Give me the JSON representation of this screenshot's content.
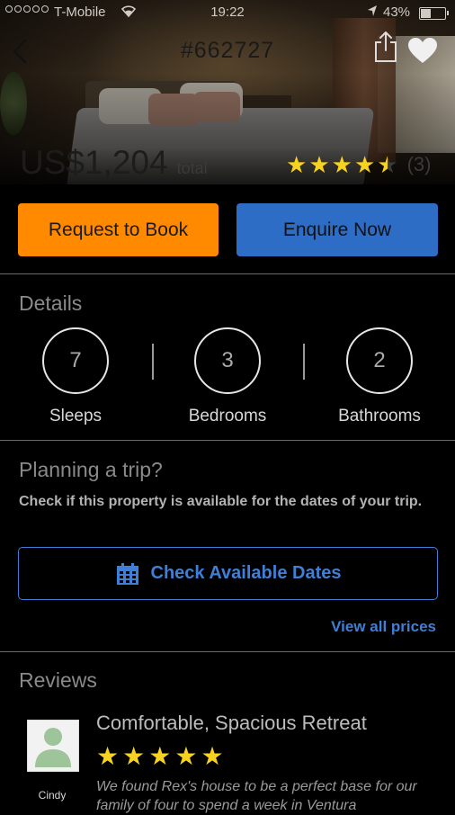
{
  "status_bar": {
    "carrier": "T-Mobile",
    "time": "19:22",
    "battery": "43%",
    "battery_level": 0.43,
    "signal_dots": 5,
    "filled_dots": 0
  },
  "header": {
    "listing_id": "#662727",
    "back_icon": "chevron-left-icon",
    "share_icon": "share-icon",
    "favorite_icon": "heart-icon"
  },
  "listing": {
    "price": "US$1,204",
    "price_unit": "total",
    "rating_stars": 4.5,
    "rating_count": "(3)"
  },
  "actions": {
    "request_label": "Request to Book",
    "enquire_label": "Enquire Now"
  },
  "details": {
    "title": "Details",
    "sleeps_value": "7",
    "sleeps_label": "Sleeps",
    "bedrooms_value": "3",
    "bedrooms_label": "Bedrooms",
    "bathrooms_value": "2",
    "bathrooms_label": "Bathrooms"
  },
  "trip": {
    "title": "Planning a trip?",
    "description": "Check if this property is available for the dates of your trip.",
    "check_dates_label": "Check Available Dates",
    "view_prices_label": "View all prices"
  },
  "reviews": {
    "title": "Reviews",
    "items": [
      {
        "reviewer": "Cindy",
        "title": "Comfortable, Spacious Retreat",
        "stars": 5,
        "text": "We found Rex's house to be a perfect base for our family of four to spend a week in Ventura"
      }
    ]
  },
  "colors": {
    "accent_orange": "#ff8a00",
    "accent_blue": "#2d6dc6",
    "link_blue": "#3f7fd6",
    "star_yellow": "#f7d21e"
  }
}
